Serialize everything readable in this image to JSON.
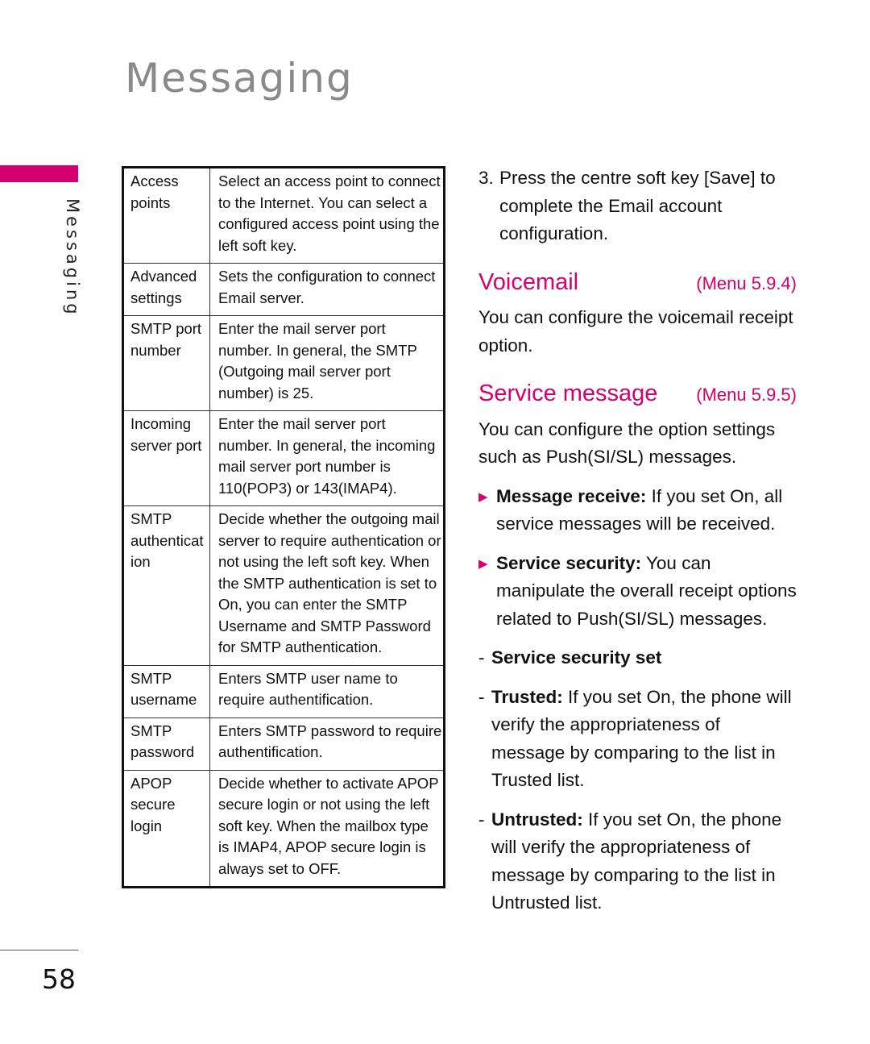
{
  "page": {
    "title": "Messaging",
    "side_label": "Messaging",
    "page_number": "58",
    "accent_color": "#d4006f"
  },
  "settings_table": {
    "rows": [
      {
        "term": "Access points",
        "desc": "Select an access point to connect to the Internet. You can select a configured access point using the left soft key."
      },
      {
        "term": "Advanced settings",
        "desc": "Sets the configuration to connect Email server."
      },
      {
        "term": "SMTP port number",
        "desc": "Enter the mail server port number. In general, the SMTP (Outgoing mail server port number) is 25."
      },
      {
        "term": "Incoming server port",
        "desc": "Enter the mail server port number. In general, the incoming mail server port number is 110(POP3) or 143(IMAP4)."
      },
      {
        "term": "SMTP authenticat ion",
        "desc": "Decide whether the outgoing mail server to require authentication or not using the left soft key. When the SMTP authentication is set to On, you can enter the SMTP Username and SMTP Password for SMTP authentication."
      },
      {
        "term": "SMTP username",
        "desc": "Enters SMTP user name to require authentification."
      },
      {
        "term": "SMTP password",
        "desc": "Enters SMTP password to require authentification."
      },
      {
        "term": "APOP secure login",
        "desc": "Decide whether to activate APOP secure login or not using the left soft key. When the mailbox type is IMAP4, APOP secure login is always set to OFF."
      }
    ]
  },
  "right_column": {
    "step3": {
      "number": "3.",
      "text": "Press the centre soft key [Save] to complete the Email account configuration."
    },
    "voicemail": {
      "title": "Voicemail",
      "menu": "(Menu 5.9.4)",
      "text": "You can configure the voicemail receipt option."
    },
    "service_message": {
      "title": "Service message",
      "menu": "(Menu 5.9.5)",
      "text": "You can configure the option settings such as Push(SI/SL) messages.",
      "bullets": [
        {
          "label": "Message receive:",
          "text": " If you set On, all service messages will be received."
        },
        {
          "label": "Service security:",
          "text": " You can manipulate the overall receipt options related to Push(SI/SL) messages."
        }
      ],
      "dash_items": [
        {
          "label": "Service security set",
          "text": ""
        },
        {
          "label": "Trusted:",
          "text": " If you set On, the phone will verify the appropriateness of message by comparing to the list in Trusted list."
        },
        {
          "label": "Untrusted:",
          "text": " If you set On, the phone will verify the appropriateness of message by comparing to the list in Untrusted list."
        }
      ]
    }
  }
}
